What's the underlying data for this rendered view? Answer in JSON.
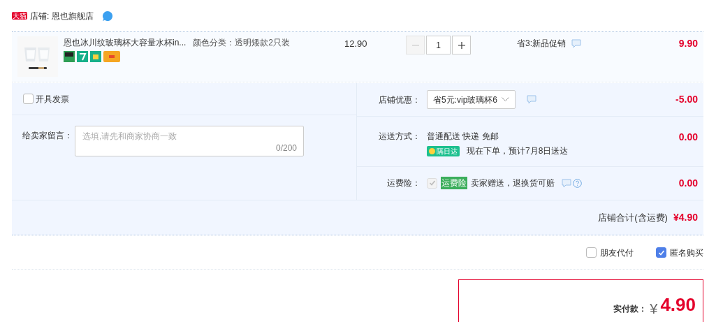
{
  "shop": {
    "badge": "天猫",
    "label": "店铺: 恩也旗舰店"
  },
  "item": {
    "title": "恩也冰川纹玻璃杯大容量水杯in...",
    "sku": "颜色分类：透明矮款2只装",
    "price": "12.90",
    "quantity": "1",
    "minus_disabled": true,
    "promo": "省3:新品促销",
    "subtotal": "9.90"
  },
  "invoice": {
    "label": "开具发票",
    "checked": false
  },
  "message": {
    "label": "给卖家留言：",
    "placeholder": "选填,请先和商家协商一致",
    "counter": "0/200"
  },
  "discount": {
    "label": "店铺优惠：",
    "value": "省5元:vip玻璃杯6",
    "amount": "-5.00"
  },
  "shipping": {
    "label": "运送方式：",
    "method": "普通配送 快递 免邮",
    "badge": "隔日达",
    "note": "现在下单，预计7月8日送达",
    "amount": "0.00"
  },
  "insurance": {
    "label": "运费险：",
    "checked": true,
    "disabled": true,
    "tag": "运费险",
    "note": "卖家赠送，退换货可赔",
    "amount": "0.00"
  },
  "shop_total": {
    "label": "店铺合计(含运费)",
    "amount": "¥4.90"
  },
  "options": [
    {
      "label": "朋友代付",
      "checked": false
    },
    {
      "label": "匿名购买",
      "checked": true
    }
  ],
  "payment": {
    "label": "实付款：",
    "currency": "¥",
    "amount": "4.90"
  }
}
